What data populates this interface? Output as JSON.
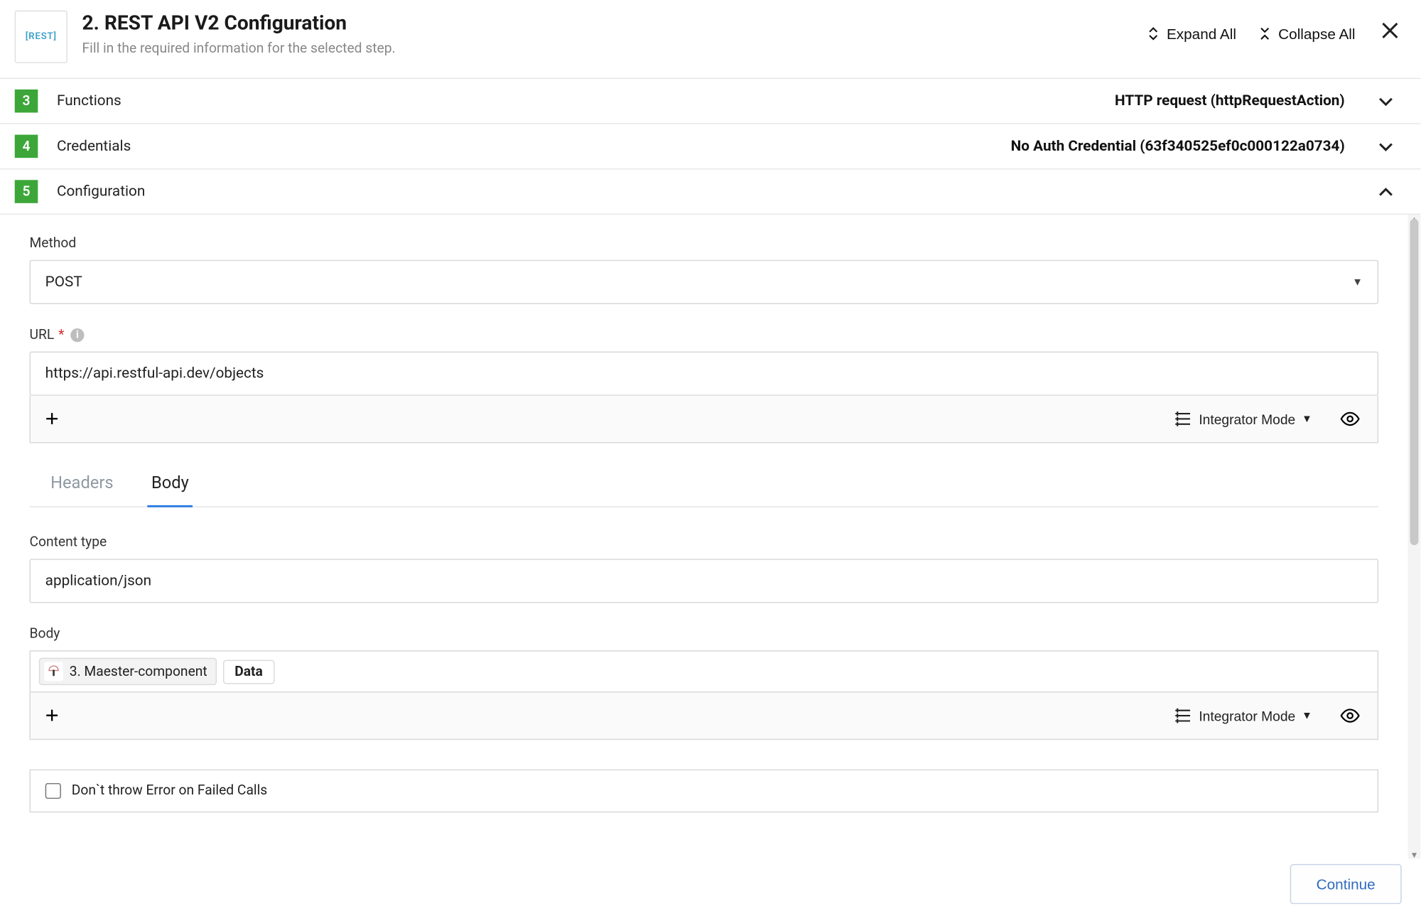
{
  "header": {
    "logo_text": "[REST]",
    "title": "2. REST API V2 Configuration",
    "subtitle": "Fill in the required information for the selected step.",
    "expand_all": "Expand All",
    "collapse_all": "Collapse All"
  },
  "sections": {
    "functions": {
      "num": "3",
      "label": "Functions",
      "summary": "HTTP request (httpRequestAction)"
    },
    "credentials": {
      "num": "4",
      "label": "Credentials",
      "summary": "No Auth Credential (63f340525ef0c000122a0734)"
    },
    "configuration": {
      "num": "5",
      "label": "Configuration"
    }
  },
  "config": {
    "method_label": "Method",
    "method_value": "POST",
    "url_label": "URL",
    "url_value": "https://api.restful-api.dev/objects",
    "integrator_mode": "Integrator Mode",
    "tabs": {
      "headers": "Headers",
      "body": "Body"
    },
    "content_type_label": "Content type",
    "content_type_value": "application/json",
    "body_label": "Body",
    "body_chip_step": "3. Maester-component",
    "body_chip_data": "Data",
    "dont_throw": "Don`t throw Error on Failed Calls"
  },
  "footer": {
    "continue": "Continue"
  }
}
